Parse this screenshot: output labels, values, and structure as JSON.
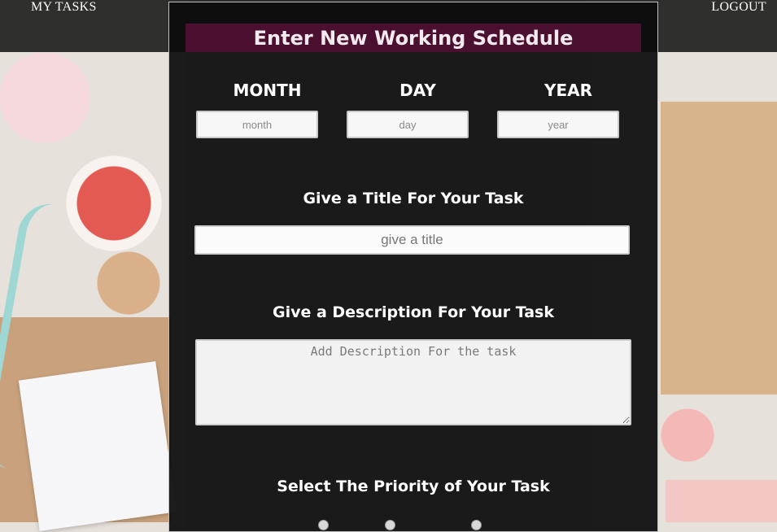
{
  "nav": {
    "my_tasks": "MY TASKS",
    "logout": "LOGOUT"
  },
  "form": {
    "title": "Enter New Working Schedule",
    "date": {
      "month_label": "MONTH",
      "day_label": "DAY",
      "year_label": "YEAR",
      "month_placeholder": "month",
      "day_placeholder": "day",
      "year_placeholder": "year"
    },
    "task_title": {
      "label": "Give a Title For Your Task",
      "placeholder": "give a title"
    },
    "description": {
      "label": "Give a Description For Your Task",
      "placeholder": "Add Description For the task"
    },
    "priority": {
      "label": "Select The Priority of Your Task"
    }
  },
  "colors": {
    "title_bar": "#4b1030",
    "panel_bg": "#0c0c0c",
    "topbar_bg": "#161616"
  }
}
